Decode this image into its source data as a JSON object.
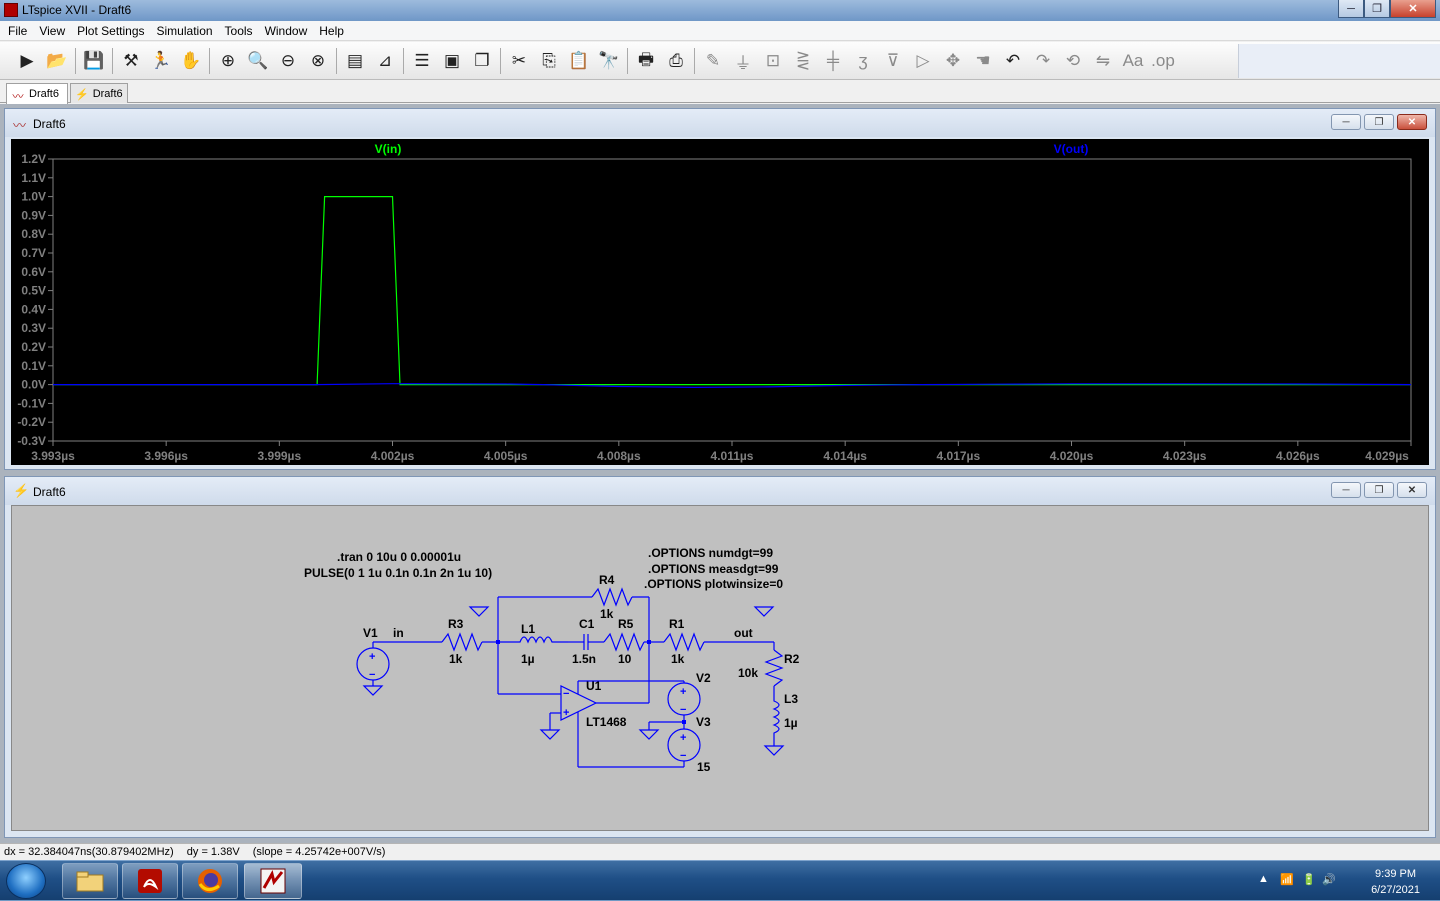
{
  "window": {
    "title": "LTspice XVII - Draft6",
    "min": "─",
    "max": "❐",
    "close": "✕"
  },
  "menu": [
    "File",
    "View",
    "Plot Settings",
    "Simulation",
    "Tools",
    "Window",
    "Help"
  ],
  "tabs": [
    {
      "label": "Draft6",
      "icon": "waveform-icon"
    },
    {
      "label": "Draft6",
      "icon": "schematic-icon"
    }
  ],
  "plot_window": {
    "title": "Draft6",
    "trace_labels": [
      "V(in)",
      "V(out)"
    ]
  },
  "schematic_window": {
    "title": "Draft6"
  },
  "chart_data": {
    "type": "line",
    "title": "",
    "xlabel": "",
    "ylabel": "",
    "x_ticks": [
      "3.993µs",
      "3.996µs",
      "3.999µs",
      "4.002µs",
      "4.005µs",
      "4.008µs",
      "4.011µs",
      "4.014µs",
      "4.017µs",
      "4.020µs",
      "4.023µs",
      "4.026µs",
      "4.029µs"
    ],
    "y_ticks": [
      "1.2V",
      "1.1V",
      "1.0V",
      "0.9V",
      "0.8V",
      "0.7V",
      "0.6V",
      "0.5V",
      "0.4V",
      "0.3V",
      "0.2V",
      "0.1V",
      "0.0V",
      "-0.1V",
      "-0.2V",
      "-0.3V"
    ],
    "xlim": [
      3.993,
      4.029
    ],
    "ylim": [
      -0.3,
      1.2
    ],
    "grid": false,
    "series": [
      {
        "name": "V(in)",
        "color": "#00ff00",
        "x": [
          3.993,
          4.0,
          4.0001,
          4.0002,
          4.002,
          4.0021,
          4.0022,
          4.029
        ],
        "y": [
          0,
          0,
          0.5,
          1.0,
          1.0,
          0.5,
          0,
          0
        ]
      },
      {
        "name": "V(out)",
        "color": "#0000ff",
        "x": [
          3.993,
          4.0,
          4.002,
          4.005,
          4.006,
          4.008,
          4.01,
          4.012,
          4.014,
          4.016,
          4.018,
          4.02,
          4.023,
          4.026,
          4.029
        ],
        "y": [
          0,
          0,
          0.005,
          0.003,
          0.0,
          -0.01,
          -0.015,
          -0.012,
          -0.004,
          0.0,
          0.002,
          0.004,
          0.004,
          0.003,
          0.0
        ]
      }
    ]
  },
  "schematic": {
    "directives": [
      ".tran 0 10u 0 0.00001u",
      "PULSE(0 1 1u 0.1n 0.1n 2n 1u 10)"
    ],
    "options": [
      ".OPTIONS numdgt=99",
      ".OPTIONS measdgt=99",
      ".OPTIONS plotwinsize=0"
    ],
    "components": [
      {
        "ref": "V1",
        "value": ""
      },
      {
        "ref": "R3",
        "value": "1k"
      },
      {
        "ref": "L1",
        "value": "1µ"
      },
      {
        "ref": "C1",
        "value": "1.5n"
      },
      {
        "ref": "R5",
        "value": "10"
      },
      {
        "ref": "R4",
        "value": "1k"
      },
      {
        "ref": "R1",
        "value": "1k"
      },
      {
        "ref": "R2",
        "value": "10k"
      },
      {
        "ref": "L3",
        "value": "1µ"
      },
      {
        "ref": "U1",
        "value": "LT1468"
      },
      {
        "ref": "V2",
        "value": ""
      },
      {
        "ref": "V3",
        "value": "15"
      }
    ],
    "net_labels": [
      "in",
      "out"
    ]
  },
  "status": {
    "dx": "dx = 32.384047ns(30.879402MHz)",
    "dy": "dy = 1.38V",
    "slope": "(slope = 4.25742e+007V/s)"
  },
  "taskbar": {
    "apps": [
      "windows-explorer-icon",
      "acrobat-icon",
      "firefox-icon",
      "ltspice-icon"
    ],
    "time": "9:39 PM",
    "date": "6/27/2021"
  }
}
